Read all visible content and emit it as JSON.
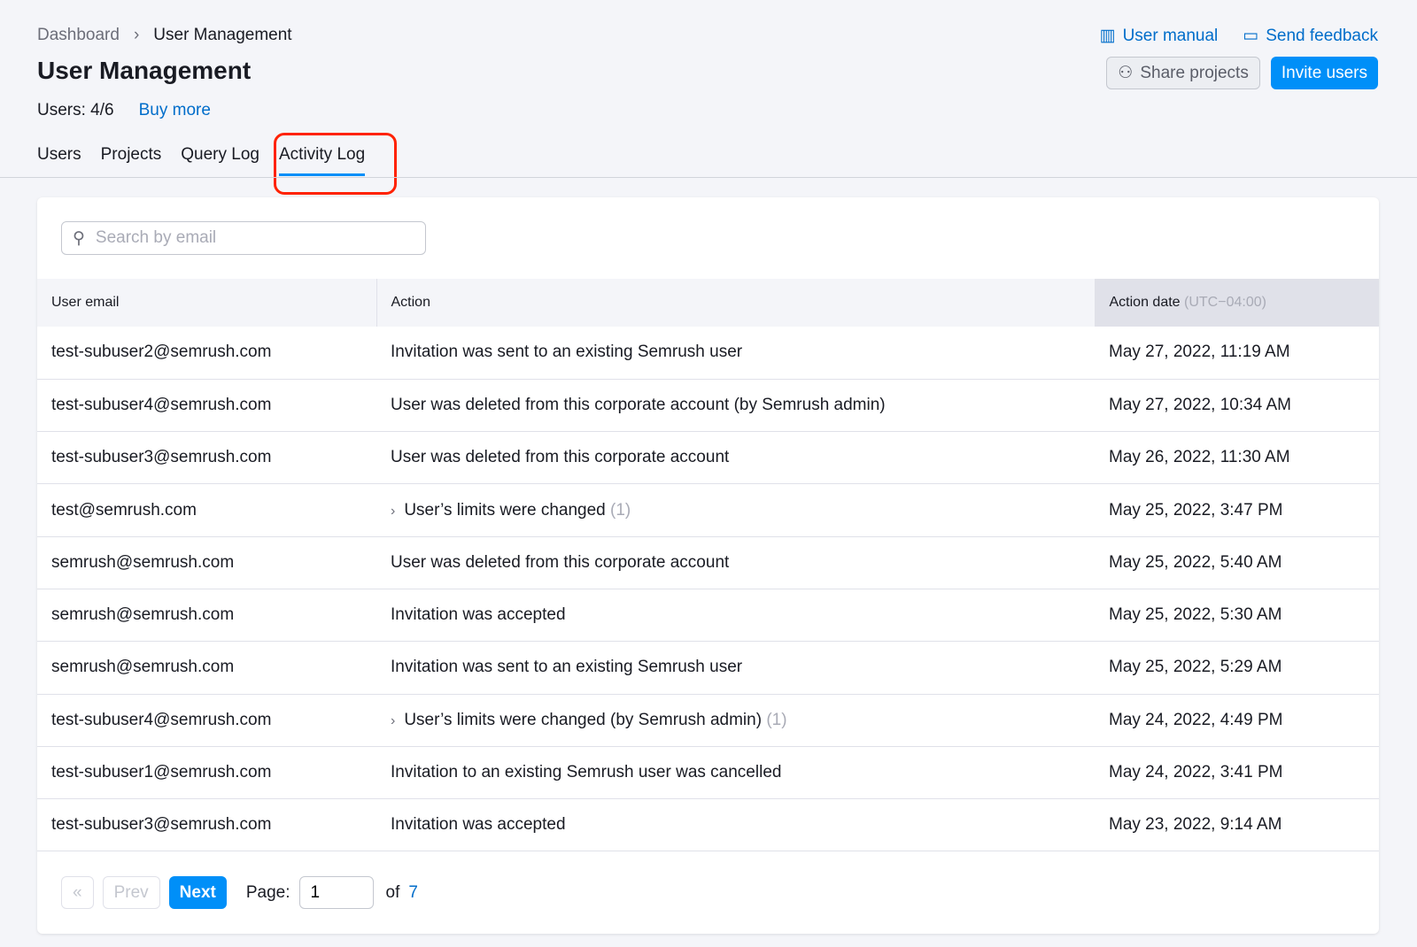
{
  "breadcrumb": {
    "parent": "Dashboard",
    "current": "User Management"
  },
  "title": "User Management",
  "users_count": "Users: 4/6",
  "buy_more": "Buy more",
  "links": {
    "manual": "User manual",
    "feedback": "Send feedback"
  },
  "buttons": {
    "share": "Share projects",
    "invite": "Invite users"
  },
  "tabs": [
    "Users",
    "Projects",
    "Query Log",
    "Activity Log"
  ],
  "search": {
    "placeholder": "Search by email"
  },
  "columns": {
    "email": "User email",
    "action": "Action",
    "date": "Action date",
    "tz": "(UTC−04:00)"
  },
  "rows": [
    {
      "email": "test-subuser2@semrush.com",
      "action": "Invitation was sent to an existing Semrush user",
      "count": "",
      "date": "May 27, 2022, 11:19 AM"
    },
    {
      "email": "test-subuser4@semrush.com",
      "action": "User was deleted from this corporate account (by Semrush admin)",
      "count": "",
      "date": "May 27, 2022, 10:34 AM"
    },
    {
      "email": "test-subuser3@semrush.com",
      "action": "User was deleted from this corporate account",
      "count": "",
      "date": "May 26, 2022, 11:30 AM"
    },
    {
      "email": "test@semrush.com",
      "action": "User’s limits were changed",
      "count": "(1)",
      "date": "May 25, 2022, 3:47 PM"
    },
    {
      "email": "semrush@semrush.com",
      "action": "User was deleted from this corporate account",
      "count": "",
      "date": "May 25, 2022, 5:40 AM"
    },
    {
      "email": "semrush@semrush.com",
      "action": "Invitation was accepted",
      "count": "",
      "date": "May 25, 2022, 5:30 AM"
    },
    {
      "email": "semrush@semrush.com",
      "action": "Invitation was sent to an existing Semrush user",
      "count": "",
      "date": "May 25, 2022, 5:29 AM"
    },
    {
      "email": "test-subuser4@semrush.com",
      "action": "User’s limits were changed (by Semrush admin)",
      "count": "(1)",
      "date": "May 24, 2022, 4:49 PM"
    },
    {
      "email": "test-subuser1@semrush.com",
      "action": "Invitation to an existing Semrush user was cancelled",
      "count": "",
      "date": "May 24, 2022, 3:41 PM"
    },
    {
      "email": "test-subuser3@semrush.com",
      "action": "Invitation was accepted",
      "count": "",
      "date": "May 23, 2022, 9:14 AM"
    }
  ],
  "pagination": {
    "first": "«",
    "prev": "Prev",
    "next": "Next",
    "page_label": "Page:",
    "page": "1",
    "of": "of",
    "total": "7"
  }
}
